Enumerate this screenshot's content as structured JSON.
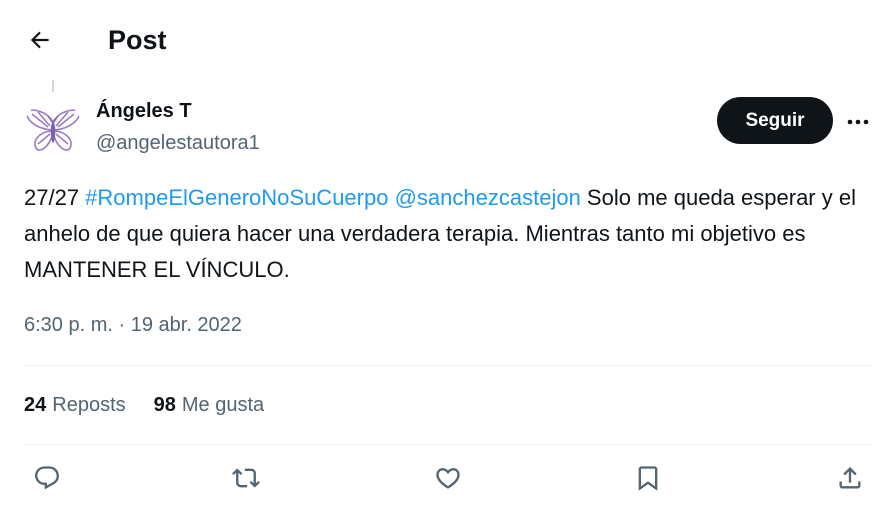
{
  "header": {
    "title": "Post",
    "back_icon": "arrow-left-icon"
  },
  "author": {
    "name": "Ángeles T",
    "handle": "@angelestautora1",
    "avatar_icon": "butterfly-icon"
  },
  "follow_button": {
    "label": "Seguir"
  },
  "more_icon": "more-horizontal-icon",
  "tweet": {
    "prefix": "27/27 ",
    "hashtag": "#RompeElGeneroNoSuCuerpo",
    "space": " ",
    "mention": "@sanchezcastejon",
    "body": " Solo me queda esperar y el anhelo de que quiera hacer una verdadera terapia. Mientras tanto mi objetivo es MANTENER EL VÍNCULO."
  },
  "timestamp": "6:30 p. m. · 19 abr. 2022",
  "stats": {
    "reposts_count": "24",
    "reposts_label": "Reposts",
    "likes_count": "98",
    "likes_label": "Me gusta"
  },
  "actions": [
    "reply-icon",
    "repost-icon",
    "like-icon",
    "bookmark-icon",
    "share-icon"
  ],
  "colors": {
    "link": "#1d9bf0",
    "secondary_text": "#536471",
    "primary_text": "#0f1419",
    "avatar_purple": "#9b7bc4"
  }
}
